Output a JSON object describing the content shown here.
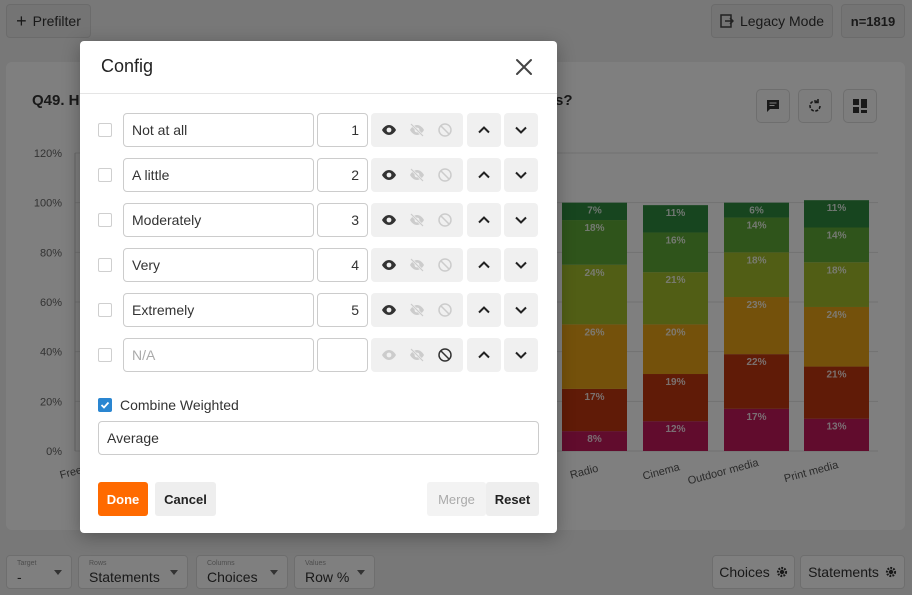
{
  "topbar": {
    "prefilter_label": "Prefilter",
    "legacy_label": "Legacy Mode",
    "n_count": "n=1819"
  },
  "question": {
    "title_start": "Q49. H",
    "title_end": "s?"
  },
  "chart_data": {
    "type": "bar",
    "stacked": true,
    "yticks": [
      "120%",
      "100%",
      "80%",
      "60%",
      "40%",
      "20%",
      "0%"
    ],
    "ylim": [
      0,
      120
    ],
    "categories": [
      "Free-t",
      "Radio",
      "Cinema",
      "Outdoor media",
      "Print media"
    ],
    "series": [
      {
        "values": [
          null,
          8,
          12,
          17,
          13
        ],
        "color": "#c2185b"
      },
      {
        "values": [
          null,
          17,
          19,
          22,
          21
        ],
        "color": "#c0360f"
      },
      {
        "values": [
          null,
          26,
          20,
          23,
          24
        ],
        "color": "#e8a317"
      },
      {
        "values": [
          null,
          24,
          21,
          18,
          18
        ],
        "color": "#a2bd2b"
      },
      {
        "values": [
          null,
          18,
          16,
          14,
          14
        ],
        "color": "#5fa836"
      },
      {
        "values": [
          null,
          7,
          11,
          6,
          11
        ],
        "color": "#2e8b3e"
      }
    ]
  },
  "bottombar": {
    "target_label": "Target",
    "target_value": "-",
    "rows_label": "Rows",
    "rows_value": "Statements",
    "columns_label": "Columns",
    "columns_value": "Choices",
    "values_label": "Values",
    "values_value": "Row %",
    "choices_btn": "Choices",
    "statements_btn": "Statements"
  },
  "modal": {
    "title": "Config",
    "rows": [
      {
        "label": "Not at all",
        "value": "1",
        "state": "visible"
      },
      {
        "label": "A little",
        "value": "2",
        "state": "visible"
      },
      {
        "label": "Moderately",
        "value": "3",
        "state": "visible"
      },
      {
        "label": "Very",
        "value": "4",
        "state": "visible"
      },
      {
        "label": "Extremely",
        "value": "5",
        "state": "visible"
      },
      {
        "label": "",
        "placeholder": "N/A",
        "value": "",
        "state": "excluded"
      }
    ],
    "combine_label": "Combine Weighted",
    "combine_checked": true,
    "combine_value": "Average",
    "done_label": "Done",
    "cancel_label": "Cancel",
    "merge_label": "Merge",
    "reset_label": "Reset"
  }
}
